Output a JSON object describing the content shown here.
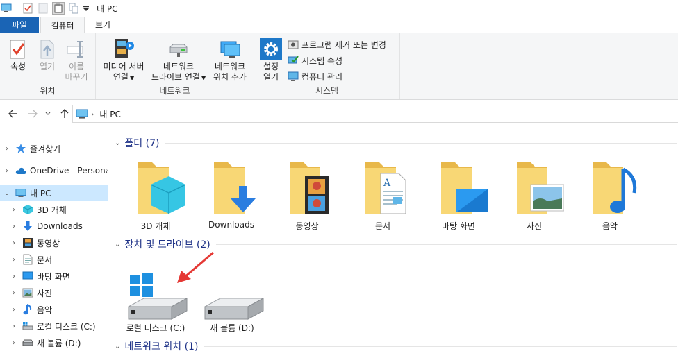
{
  "window": {
    "title": "내 PC"
  },
  "tabs": [
    {
      "label": "파일"
    },
    {
      "label": "컴퓨터"
    },
    {
      "label": "보기"
    }
  ],
  "ribbon": {
    "location": {
      "label": "위치",
      "properties": "속성",
      "open": "열기",
      "rename_line1": "이름",
      "rename_line2": "바꾸기"
    },
    "network": {
      "label": "네트워크",
      "media_line1": "미디어 서버",
      "media_line2": "연결",
      "map_line1": "네트워크",
      "map_line2": "드라이브 연결",
      "add_line1": "네트워크",
      "add_line2": "위치 추가"
    },
    "system": {
      "label": "시스템",
      "settings_line1": "설정",
      "settings_line2": "열기",
      "uninstall": "프로그램 제거 또는 변경",
      "system_props": "시스템 속성",
      "manage": "컴퓨터 관리"
    }
  },
  "address": {
    "path": "내 PC"
  },
  "navpane": {
    "items": [
      {
        "label": "즐겨찾기"
      },
      {
        "label": "OneDrive - Personal"
      },
      {
        "label": "내 PC"
      },
      {
        "label": "3D 개체"
      },
      {
        "label": "Downloads"
      },
      {
        "label": "동영상"
      },
      {
        "label": "문서"
      },
      {
        "label": "바탕 화면"
      },
      {
        "label": "사진"
      },
      {
        "label": "음악"
      },
      {
        "label": "로컬 디스크 (C:)"
      },
      {
        "label": "새 볼륨 (D:)"
      }
    ]
  },
  "content": {
    "folders_header": "폴더 (7)",
    "folders": [
      {
        "label": "3D 개체"
      },
      {
        "label": "Downloads"
      },
      {
        "label": "동영상"
      },
      {
        "label": "문서"
      },
      {
        "label": "바탕 화면"
      },
      {
        "label": "사진"
      },
      {
        "label": "음악"
      }
    ],
    "drives_header": "장치 및 드라이브 (2)",
    "drives": [
      {
        "label": "로컬 디스크 (C:)"
      },
      {
        "label": "새 볼륨 (D:)"
      }
    ],
    "network_header": "네트워크 위치 (1)"
  },
  "colors": {
    "accent": "#1a64b5",
    "selection": "#cce8ff",
    "folder": "#f8d775",
    "header_text": "#1e3287",
    "arrow": "#e53935"
  }
}
